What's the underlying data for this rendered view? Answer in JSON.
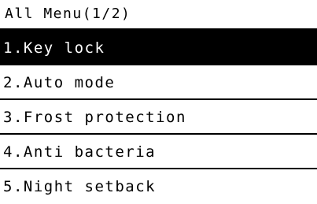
{
  "header": {
    "title": "All Menu(1/2)"
  },
  "menu": {
    "selected_index": 0,
    "items": [
      {
        "label": "1.Key lock"
      },
      {
        "label": "2.Auto mode"
      },
      {
        "label": "3.Frost protection"
      },
      {
        "label": "4.Anti bacteria"
      },
      {
        "label": "5.Night setback"
      }
    ]
  },
  "colors": {
    "background": "#ffffff",
    "foreground": "#000000",
    "selected_background": "#000000",
    "selected_foreground": "#ffffff"
  }
}
